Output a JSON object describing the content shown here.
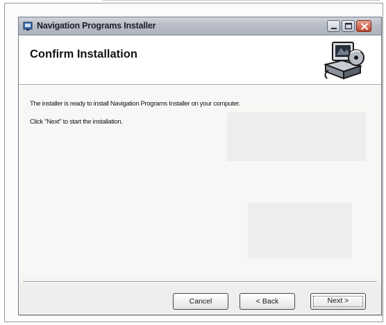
{
  "window": {
    "title": "Navigation Programs Installer",
    "controls": {
      "minimize": "minimize-icon",
      "maximize": "maximize-icon",
      "close": "close-icon"
    }
  },
  "header": {
    "title": "Confirm Installation",
    "graphic": "computer-install-icon"
  },
  "content": {
    "line1": "The installer is ready to install Navigation Programs Installer on your computer.",
    "line2": "Click \"Next\" to start the installation."
  },
  "buttons": {
    "cancel": "Cancel",
    "back": "< Back",
    "next": "Next >"
  },
  "colors": {
    "titlebar": "#b8bdc6",
    "close_button": "#c0472f",
    "window_background": "#f4f4f2"
  }
}
